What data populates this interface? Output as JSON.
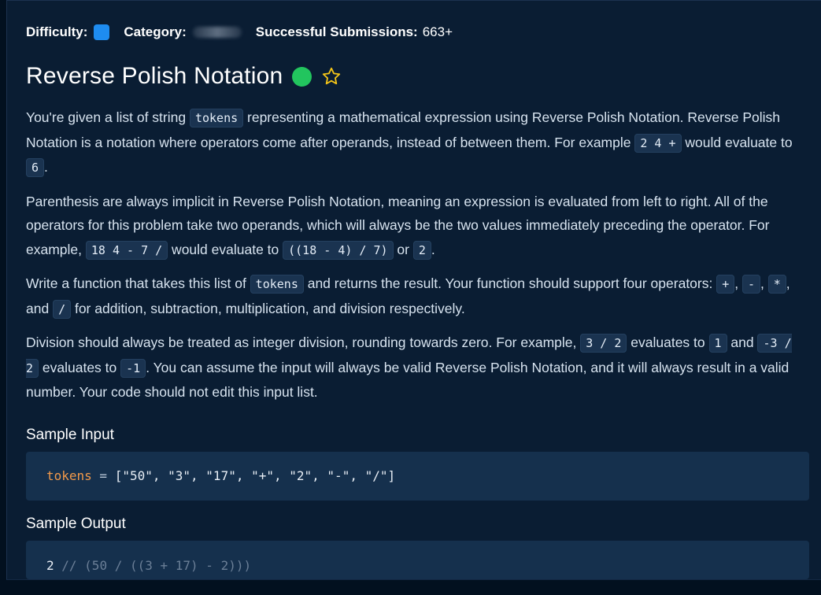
{
  "meta": {
    "difficulty_label": "Difficulty:",
    "difficulty_color": "#1e8cf0",
    "category_label": "Category:",
    "submissions_label": "Successful Submissions:",
    "submissions_value": "663+"
  },
  "problem": {
    "title": "Reverse Polish Notation",
    "status_color": "#22c55e",
    "favorite_icon": "star-outline-icon"
  },
  "description": {
    "p1": {
      "t1": "You're given a list of string ",
      "c1": "tokens",
      "t2": " representing a mathematical expression using Reverse Polish Notation. Reverse Polish Notation is a notation where operators come after operands, instead of between them. For example ",
      "c2": "2 4 +",
      "t3": " would evaluate to ",
      "c3": "6",
      "t4": "."
    },
    "p2": {
      "t1": "Parenthesis are always implicit in Reverse Polish Notation, meaning an expression is evaluated from left to right. All of the operators for this problem take two operands, which will always be the two values immediately preceding the operator. For example, ",
      "c1": "18 4 - 7 /",
      "t2": " would evaluate to ",
      "c2": "((18 - 4) / 7)",
      "t3": " or ",
      "c3": "2",
      "t4": "."
    },
    "p3": {
      "t1": "Write a function that takes this list of ",
      "c1": "tokens",
      "t2": " and returns the result. Your function should support four operators: ",
      "c2": "+",
      "t3": ", ",
      "c3": "-",
      "t4": ", ",
      "c4": "*",
      "t5": ", and ",
      "c5": "/",
      "t6": " for addition, subtraction, multiplication, and division respectively."
    },
    "p4": {
      "t1": "Division should always be treated as integer division, rounding towards zero. For example, ",
      "c1": "3 / 2",
      "t2": " evaluates to ",
      "c2": "1",
      "t3": " and ",
      "c3": "-3 / 2",
      "t4": " evaluates to ",
      "c4": "-1",
      "t5": ". You can assume the input will always be valid Reverse Polish Notation, and it will always result in a valid number. Your code should not edit this input list."
    }
  },
  "sample_input": {
    "heading": "Sample Input",
    "var": "tokens",
    "op": " = ",
    "value": "[\"50\", \"3\", \"17\", \"+\", \"2\", \"-\", \"/\"]"
  },
  "sample_output": {
    "heading": "Sample Output",
    "value": "2",
    "comment": " // (50 / ((3 + 17) - 2)))"
  }
}
